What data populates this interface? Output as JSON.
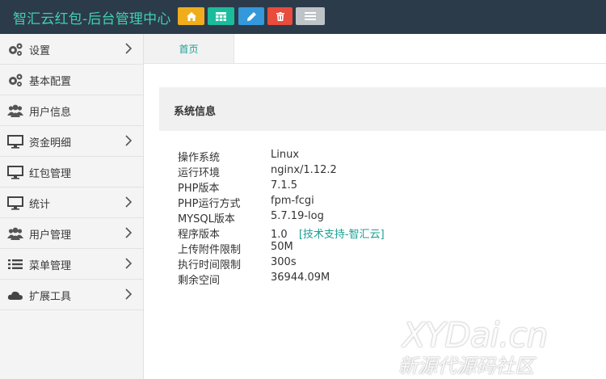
{
  "header": {
    "brand": "智汇云红包-后台管理中心",
    "buttons": [
      {
        "icon": "home-icon",
        "color": "#f0ad1b"
      },
      {
        "icon": "calendar-icon",
        "color": "#1abc9c"
      },
      {
        "icon": "pencil-icon",
        "color": "#3498db"
      },
      {
        "icon": "trash-icon",
        "color": "#e74c3c"
      },
      {
        "icon": "list-icon",
        "color": "#bdc3c7"
      }
    ]
  },
  "sidebar": {
    "items": [
      {
        "label": "设置",
        "icon": "gears-icon",
        "has_arrow": true
      },
      {
        "label": "基本配置",
        "icon": "gears-icon",
        "has_arrow": false
      },
      {
        "label": "用户信息",
        "icon": "users-icon",
        "has_arrow": false
      },
      {
        "label": "资金明细",
        "icon": "monitor-icon",
        "has_arrow": true
      },
      {
        "label": "红包管理",
        "icon": "monitor-icon",
        "has_arrow": false
      },
      {
        "label": "统计",
        "icon": "monitor-icon",
        "has_arrow": true
      },
      {
        "label": "用户管理",
        "icon": "users-icon",
        "has_arrow": true
      },
      {
        "label": "菜单管理",
        "icon": "list-icon",
        "has_arrow": true
      },
      {
        "label": "扩展工具",
        "icon": "cloud-icon",
        "has_arrow": true
      }
    ]
  },
  "tabs": [
    {
      "label": "首页"
    }
  ],
  "panel": {
    "title": "系统信息",
    "rows": [
      {
        "key": "操作系统",
        "value": "Linux"
      },
      {
        "key": "运行环境",
        "value": "nginx/1.12.2"
      },
      {
        "key": "PHP版本",
        "value": "7.1.5"
      },
      {
        "key": "PHP运行方式",
        "value": "fpm-fcgi"
      },
      {
        "key": "MYSQL版本",
        "value": "5.7.19-log"
      },
      {
        "key": "程序版本",
        "value": "1.0",
        "link": "[技术支持-智汇云]"
      },
      {
        "key": "上传附件限制",
        "value": "50M"
      },
      {
        "key": "执行时间限制",
        "value": "300s"
      },
      {
        "key": "剩余空间",
        "value": "36944.09M"
      }
    ]
  },
  "watermark": {
    "line1": "XYDai.cn",
    "line2": "新源代源码社区"
  }
}
